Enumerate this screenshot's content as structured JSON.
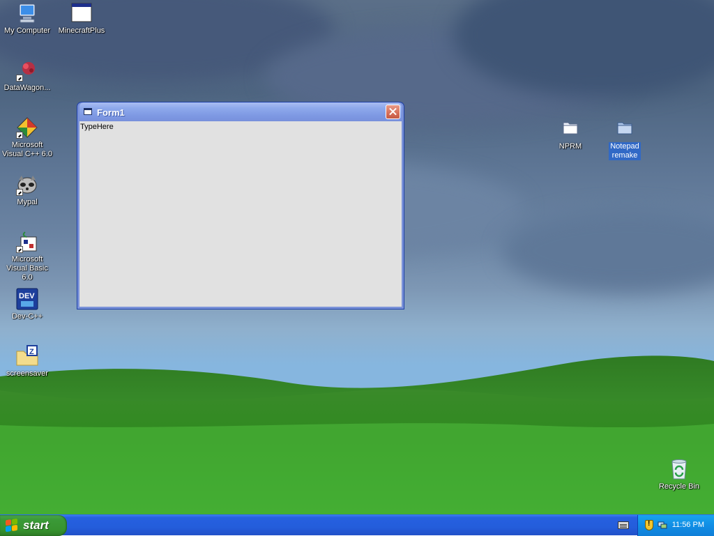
{
  "desktop": {
    "icons": [
      {
        "label": "My Computer",
        "selected": false
      },
      {
        "label": "MinecraftPlus",
        "selected": false
      },
      {
        "label": "DataWagon...",
        "selected": false
      },
      {
        "label": "Microsoft Visual C++ 6.0",
        "selected": false
      },
      {
        "label": "Mypal",
        "selected": false
      },
      {
        "label": "Microsoft Visual Basic 6.0",
        "selected": false
      },
      {
        "label": "Dev-C++",
        "selected": false
      },
      {
        "label": "screensaver",
        "selected": false
      },
      {
        "label": "NPRM",
        "selected": false
      },
      {
        "label": "Notepad remake",
        "selected": true
      },
      {
        "label": "Recycle Bin",
        "selected": false
      }
    ]
  },
  "window": {
    "title": "Form1",
    "content_text": "TypeHere"
  },
  "taskbar": {
    "start_label": "start",
    "clock": "11:56 PM"
  },
  "colors": {
    "taskbar": "#245ddb",
    "start_button": "#3b9a38",
    "tray": "#118ee5",
    "selection": "#3169c6",
    "window_frame": "#7a92d8",
    "window_client": "#e1e1e1"
  },
  "icon_names": {
    "my_computer": "computer-icon",
    "minecraftplus": "window-app-icon",
    "datawagon": "datawagon-icon",
    "vcpp": "visual-cpp-icon",
    "mypal": "mypal-raccoon-icon",
    "vb6": "visual-basic-icon",
    "devcpp": "dev-cpp-icon",
    "screensaver": "zip-folder-icon",
    "nprm": "folder-icon",
    "notepad_remake": "folder-icon",
    "recycle_bin": "recycle-bin-icon"
  }
}
